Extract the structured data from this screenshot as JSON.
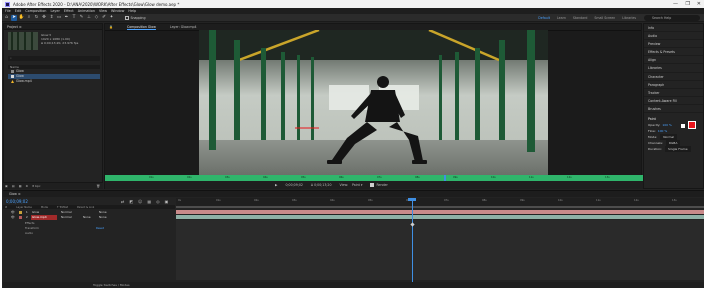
{
  "window": {
    "title": "Adobe After Effects 2020 - D:\\ANA\\2020\\WORK\\After Effects\\Glow\\Glow demo.aep *",
    "controls": [
      "—",
      "❐",
      "✕"
    ]
  },
  "menu": [
    "File",
    "Edit",
    "Composition",
    "Layer",
    "Effect",
    "Animation",
    "View",
    "Window",
    "Help"
  ],
  "toolbar": {
    "tools": [
      "home-icon",
      "selection-tool-icon",
      "hand-tool-icon",
      "zoom-tool-icon",
      "orbit-camera-icon",
      "pan-camera-icon",
      "dolly-camera-icon",
      "rectangle-tool-icon",
      "pen-tool-icon",
      "type-tool-icon",
      "brush-tool-icon",
      "clone-stamp-icon",
      "eraser-icon",
      "roto-brush-icon",
      "puppet-pin-icon"
    ],
    "snapping_label": "Snapping",
    "workspaces": [
      "Default",
      "Learn",
      "Standard",
      "Small Screen",
      "Libraries"
    ],
    "active_workspace": "Default",
    "search_placeholder": "Search Help"
  },
  "project": {
    "tab": "Project ≡",
    "comp_name": "Glow ▾",
    "comp_info": [
      "1920 x 1080 (1.00)",
      "Δ 0;00;13;20, 23.976 fps"
    ],
    "search_placeholder": "⌕",
    "list_header": "Name",
    "items": [
      {
        "name": "Glow",
        "color": "#8a8a8a",
        "selected": false
      },
      {
        "name": "Glow",
        "color": "#d9d9d9",
        "selected": true
      },
      {
        "name": "Glow.mp4",
        "color": "#f0b429",
        "selected": false
      }
    ],
    "footer": "8 bpc"
  },
  "composition": {
    "tabs": [
      "Composition Glow",
      "Layer: Glow.mp4"
    ],
    "active_tab": 0,
    "header_icon": "lock-icon",
    "ruler_marks": [
      "0s",
      "01s",
      "02s",
      "03s",
      "04s",
      "05s",
      "06s",
      "07s",
      "08s",
      "09s",
      "10s",
      "11s",
      "12s",
      "13s"
    ],
    "controls": [
      "▶",
      "0;00;09;02",
      "Δ 0;00;13;20",
      "View:",
      "Render"
    ],
    "zoom": "100%",
    "resolution": "Full",
    "bottom_time": "0;00;09;02"
  },
  "right_panel": {
    "items": [
      "Info",
      "Audio",
      "Preview",
      "Effects & Presets",
      "Align",
      "Libraries",
      "Character",
      "Paragraph",
      "Tracker",
      "Content-Aware Fill",
      "Brushes",
      "Paint"
    ],
    "paint": {
      "opacity_label": "Opacity:",
      "opacity_value": "100 %",
      "flow_label": "Flow:",
      "flow_value": "100 %",
      "mode_label": "Mode:",
      "mode_value": "Normal",
      "channels_label": "Channels:",
      "channels_value": "RGBA",
      "duration_label": "Duration:",
      "duration_value": "Single Frame",
      "foreground_color": "#e8141b"
    }
  },
  "timeline": {
    "tab": "Glow ≡",
    "current_time": "0;00;09;02",
    "columns": [
      "#",
      "Layer Name",
      "Mode",
      "T TrkMat",
      "Parent & Link"
    ],
    "layers": [
      {
        "index": "1",
        "name": "Glow",
        "mode": "Normal",
        "trkmat": "",
        "parent": "None",
        "tag": "#c7a23a",
        "selected": false
      },
      {
        "index": "2",
        "name": "Glow.mp4",
        "mode": "Normal",
        "trkmat": "None",
        "parent": "None",
        "tag": "#b55a5a",
        "selected": true
      }
    ],
    "properties": [
      "Effects",
      "Transform",
      "Audio"
    ],
    "transform_reset": "Reset",
    "ruler": [
      "0s",
      "01s",
      "02s",
      "03s",
      "04s",
      "05s",
      "06s",
      "07s",
      "08s",
      "09s",
      "10s",
      "11s",
      "12s",
      "13s"
    ],
    "footer": "Toggle Switches / Modes"
  }
}
